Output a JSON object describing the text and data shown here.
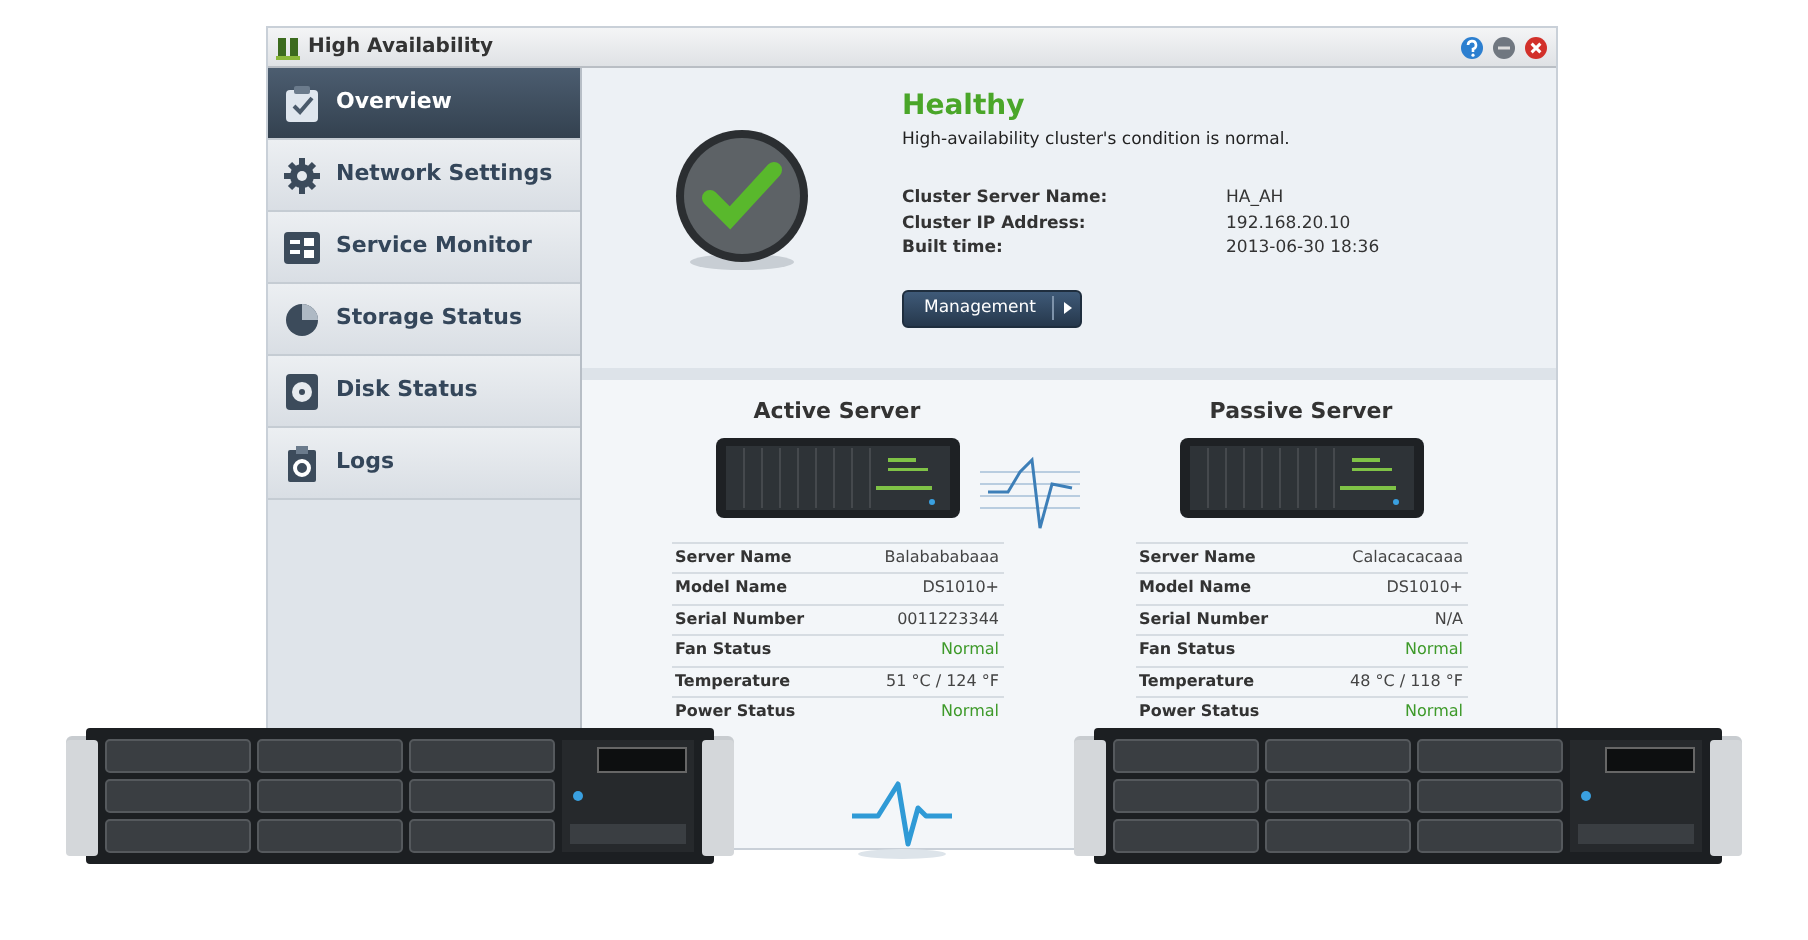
{
  "window": {
    "title": "High Availability"
  },
  "sidebar": {
    "items": [
      {
        "label": "Overview",
        "kind": "clipboard",
        "selected": true
      },
      {
        "label": "Network Settings",
        "kind": "gear",
        "selected": false
      },
      {
        "label": "Service Monitor",
        "kind": "monitor",
        "selected": false
      },
      {
        "label": "Storage Status",
        "kind": "pie",
        "selected": false
      },
      {
        "label": "Disk Status",
        "kind": "disk",
        "selected": false
      },
      {
        "label": "Logs",
        "kind": "logs",
        "selected": false
      }
    ]
  },
  "status": {
    "title": "Healthy",
    "description": "High-availability cluster's condition is normal.",
    "fields": [
      {
        "label": "Cluster Server Name:",
        "value": "HA_AH"
      },
      {
        "label": "Cluster IP Address:",
        "value": "192.168.20.10"
      },
      {
        "label": "Built time:",
        "value": "2013-06-30 18:36"
      }
    ],
    "button": "Management"
  },
  "servers": [
    {
      "title": "Active Server",
      "rows": [
        {
          "label": "Server Name",
          "value": "Balabababaaa",
          "kind": "text"
        },
        {
          "label": "Model Name",
          "value": "DS1010+",
          "kind": "text"
        },
        {
          "label": "Serial Number",
          "value": "0011223344",
          "kind": "text"
        },
        {
          "label": "Fan Status",
          "value": "Normal",
          "kind": "status"
        },
        {
          "label": "Temperature",
          "value": "51 °C / 124 °F",
          "kind": "text"
        },
        {
          "label": "Power Status",
          "value": "Normal",
          "kind": "status"
        }
      ]
    },
    {
      "title": "Passive Server",
      "rows": [
        {
          "label": "Server Name",
          "value": "Calacacacaaa",
          "kind": "text"
        },
        {
          "label": "Model Name",
          "value": "DS1010+",
          "kind": "text"
        },
        {
          "label": "Serial Number",
          "value": "N/A",
          "kind": "text"
        },
        {
          "label": "Fan Status",
          "value": "Normal",
          "kind": "status"
        },
        {
          "label": "Temperature",
          "value": "48 °C / 118 °F",
          "kind": "text"
        },
        {
          "label": "Power Status",
          "value": "Normal",
          "kind": "status"
        }
      ]
    }
  ]
}
